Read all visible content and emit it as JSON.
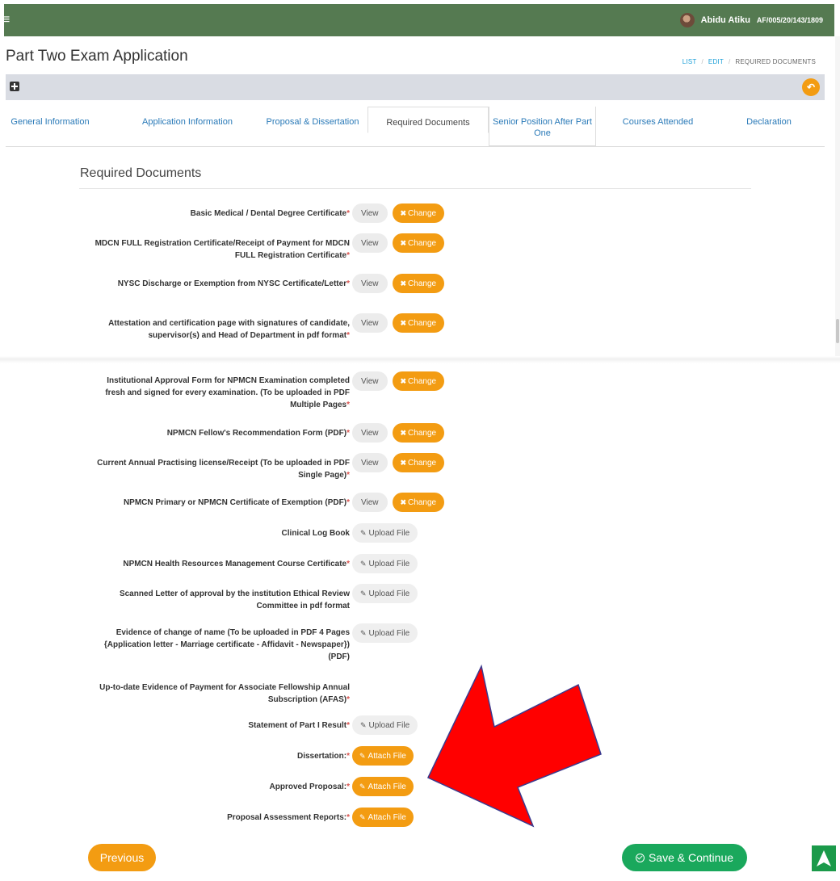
{
  "topbar": {
    "user_name": "Abidu Atiku",
    "user_id": "AF/005/20/143/1809"
  },
  "page": {
    "title": "Part Two Exam Application"
  },
  "breadcrumb": {
    "list": "LIST",
    "sep1": "/",
    "edit": "EDIT",
    "sep2": "/",
    "current": "REQUIRED DOCUMENTS"
  },
  "tabs": [
    {
      "label": "General Information"
    },
    {
      "label": "Application Information"
    },
    {
      "label": "Proposal & Dissertation"
    },
    {
      "label": "Required Documents"
    },
    {
      "label": "Senior Position After Part One"
    },
    {
      "label": "Courses Attended"
    },
    {
      "label": "Declaration"
    }
  ],
  "section": {
    "title": "Required Documents"
  },
  "buttons": {
    "view": "View",
    "change": "Change",
    "upload": "Upload File",
    "attach": "Attach File",
    "previous": "Previous",
    "save": "Save & Continue"
  },
  "documents": [
    {
      "label": "Basic Medical / Dental Degree Certificate",
      "required": "*"
    },
    {
      "label": "MDCN FULL Registration Certificate/Receipt of Payment for MDCN FULL Registration Certificate",
      "required": "*"
    },
    {
      "label": "NYSC Discharge or Exemption from NYSC Certificate/Letter",
      "required": "*"
    },
    {
      "label": "Attestation and certification page with signatures of candidate, supervisor(s) and Head of Department in pdf format",
      "required": "*"
    },
    {
      "label": "Institutional Approval Form for NPMCN Examination completed fresh and signed for every examination. (To be uploaded in PDF Multiple Pages",
      "required": "*"
    },
    {
      "label": "NPMCN Fellow's Recommendation Form (PDF)",
      "required": "*"
    },
    {
      "label": "Current Annual Practising license/Receipt (To be uploaded in PDF Single Page)",
      "required": "*"
    },
    {
      "label": "NPMCN Primary or NPMCN Certificate of Exemption (PDF)",
      "required": "*"
    },
    {
      "label": "Clinical Log Book",
      "required": ""
    },
    {
      "label": "NPMCN Health Resources Management Course Certificate",
      "required": "*"
    },
    {
      "label": "Scanned Letter of approval by the institution Ethical Review Committee in pdf format",
      "required": ""
    },
    {
      "label": "Evidence of change of name (To be uploaded in PDF 4 Pages {Application letter - Marriage certificate - Affidavit - Newspaper}) (PDF)",
      "required": ""
    },
    {
      "label": "Up-to-date Evidence of Payment for Associate Fellowship Annual Subscription (AFAS)",
      "required": "*"
    },
    {
      "label": "Statement of Part I Result",
      "required": "*"
    },
    {
      "label": "Dissertation:",
      "required": "*"
    },
    {
      "label": "Approved Proposal:",
      "required": "*"
    },
    {
      "label": "Proposal Assessment Reports:",
      "required": "*"
    }
  ],
  "colors": {
    "header": "#557a51",
    "accent": "#f39c12",
    "success": "#1aa85c",
    "link": "#2a7ab8",
    "annotation_arrow": "#ff0000"
  },
  "icons": {
    "menu": "hamburger-icon",
    "add": "plus-square-icon",
    "back": "reply-icon",
    "change": "times-icon",
    "upload": "paperclip-icon",
    "save": "check-circle-icon",
    "scroll_top": "arrow-up-icon"
  }
}
